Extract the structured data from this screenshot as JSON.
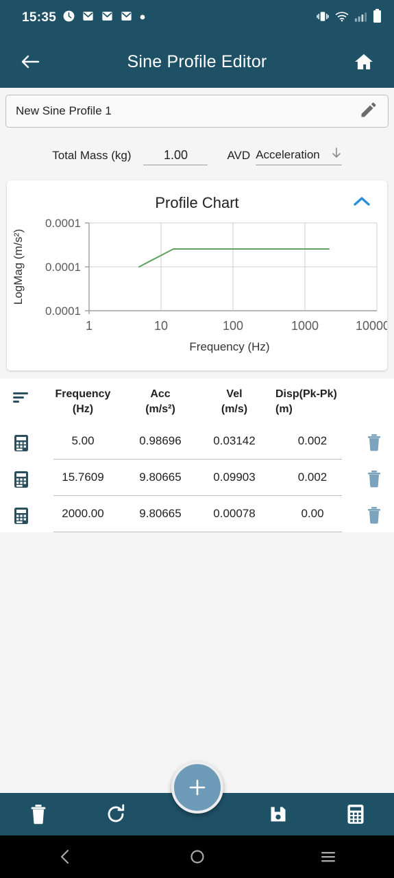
{
  "status_bar": {
    "time": "15:35",
    "left_icons": [
      "alarm-clock-icon",
      "mail-icon",
      "mail-icon",
      "mail-icon",
      "dot-indicator-icon"
    ],
    "right_icons": [
      "vibrate-icon",
      "wifi-icon",
      "signal-bars-icon",
      "battery-icon"
    ]
  },
  "app_bar": {
    "title": "Sine Profile Editor",
    "back_icon": "arrow-left-icon",
    "home_icon": "home-icon",
    "background": "#1e5066"
  },
  "profile_name": {
    "value": "New Sine Profile 1",
    "edit_icon": "pencil-icon"
  },
  "params": {
    "mass_label": "Total Mass (kg)",
    "mass_value": "1.00",
    "avd_label": "AVD",
    "avd_value": "Acceleration",
    "avd_dropdown_icon": "arrow-down-icon"
  },
  "chart_card": {
    "title": "Profile Chart",
    "collapse_icon": "chevron-up-icon",
    "collapse_color": "#2b8fd9"
  },
  "chart_data": {
    "type": "line",
    "title": "Profile Chart",
    "xlabel": "Frequency (Hz)",
    "ylabel": "LogMag (m/s²)",
    "x_scale": "log",
    "y_scale": "log",
    "xlim": [
      1,
      10000
    ],
    "x_ticks": [
      1,
      10,
      100,
      1000,
      10000
    ],
    "x_tick_labels": [
      "1",
      "10",
      "100",
      "1000",
      "10000"
    ],
    "y_tick_labels": [
      "0.0001",
      "0.0001",
      "0.0001"
    ],
    "grid": true,
    "legend": "none",
    "line_color": "#5fa35f",
    "series": [
      {
        "name": "Acceleration",
        "x": [
          5.0,
          15.7609,
          2000.0
        ],
        "y": [
          0.98696,
          9.80665,
          9.80665
        ]
      }
    ]
  },
  "table": {
    "sort_icon": "sort-icon",
    "headers": [
      {
        "line1": "Frequency",
        "line2": "(Hz)"
      },
      {
        "line1": "Acc",
        "line2": "(m/s²)"
      },
      {
        "line1": "Vel",
        "line2": "(m/s)"
      },
      {
        "line1": "Disp(Pk-Pk)",
        "line2": "(m)"
      }
    ],
    "row_icon": "calculator-icon",
    "delete_icon": "trash-icon",
    "rows": [
      {
        "frequency": "5.00",
        "acc": "0.98696",
        "vel": "0.03142",
        "disp": "0.002"
      },
      {
        "frequency": "15.7609",
        "acc": "9.80665",
        "vel": "0.09903",
        "disp": "0.002"
      },
      {
        "frequency": "2000.00",
        "acc": "9.80665",
        "vel": "0.00078",
        "disp": "0.00"
      }
    ]
  },
  "bottom_bar": {
    "background": "#1e5066",
    "fab": {
      "icon": "plus-icon",
      "color": "#6e9cb8"
    },
    "buttons": [
      {
        "icon": "trash-icon"
      },
      {
        "icon": "refresh-icon"
      },
      {
        "icon": "save-floppy-icon"
      },
      {
        "icon": "calculator-icon"
      }
    ]
  },
  "nav_bar": {
    "buttons": [
      {
        "icon": "back-chevron-icon"
      },
      {
        "icon": "home-circle-icon"
      },
      {
        "icon": "recents-menu-icon"
      }
    ]
  }
}
